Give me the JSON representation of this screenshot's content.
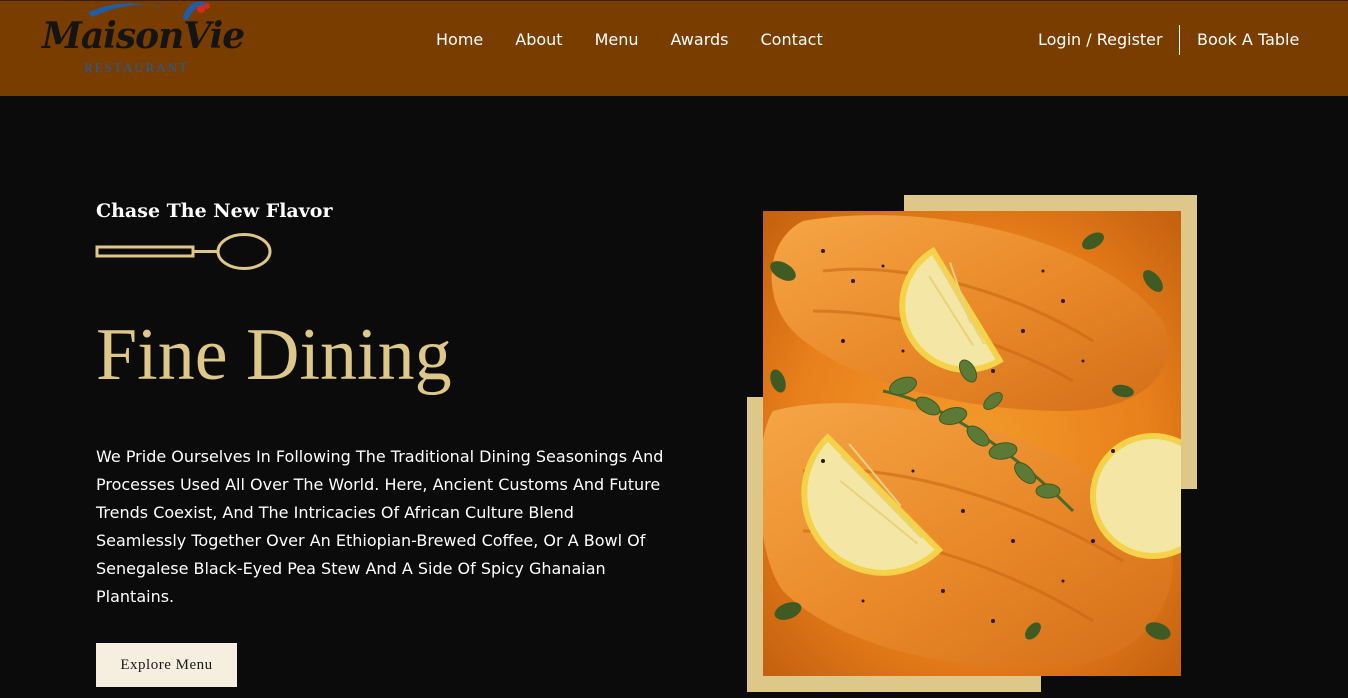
{
  "colors": {
    "header_bg": "#7a3d00",
    "page_bg": "#0b0b0b",
    "accent_gold": "#ddc88a",
    "button_bg": "#f6efdf"
  },
  "brand": {
    "name": "MaisonVie",
    "sub": "RESTAURANT"
  },
  "nav": {
    "items": [
      "Home",
      "About",
      "Menu",
      "Awards",
      "Contact"
    ]
  },
  "header": {
    "auth_label": "Login / Register",
    "book_label": "Book A Table"
  },
  "hero": {
    "tagline": "Chase The New Flavor",
    "title": "Fine Dining",
    "description": "We Pride Ourselves In Following The Traditional Dining Seasonings And Processes Used All Over The World. Here, Ancient Customs And Future Trends Coexist, And The Intricacies Of African Culture Blend Seamlessly Together Over An Ethiopian-Brewed Coffee, Or A Bowl Of Senegalese Black-Eyed Pea Stew And A Side Of Spicy Ghanaian Plantains.",
    "button_label": "Explore Menu",
    "divider_icon": "spoon-icon"
  }
}
